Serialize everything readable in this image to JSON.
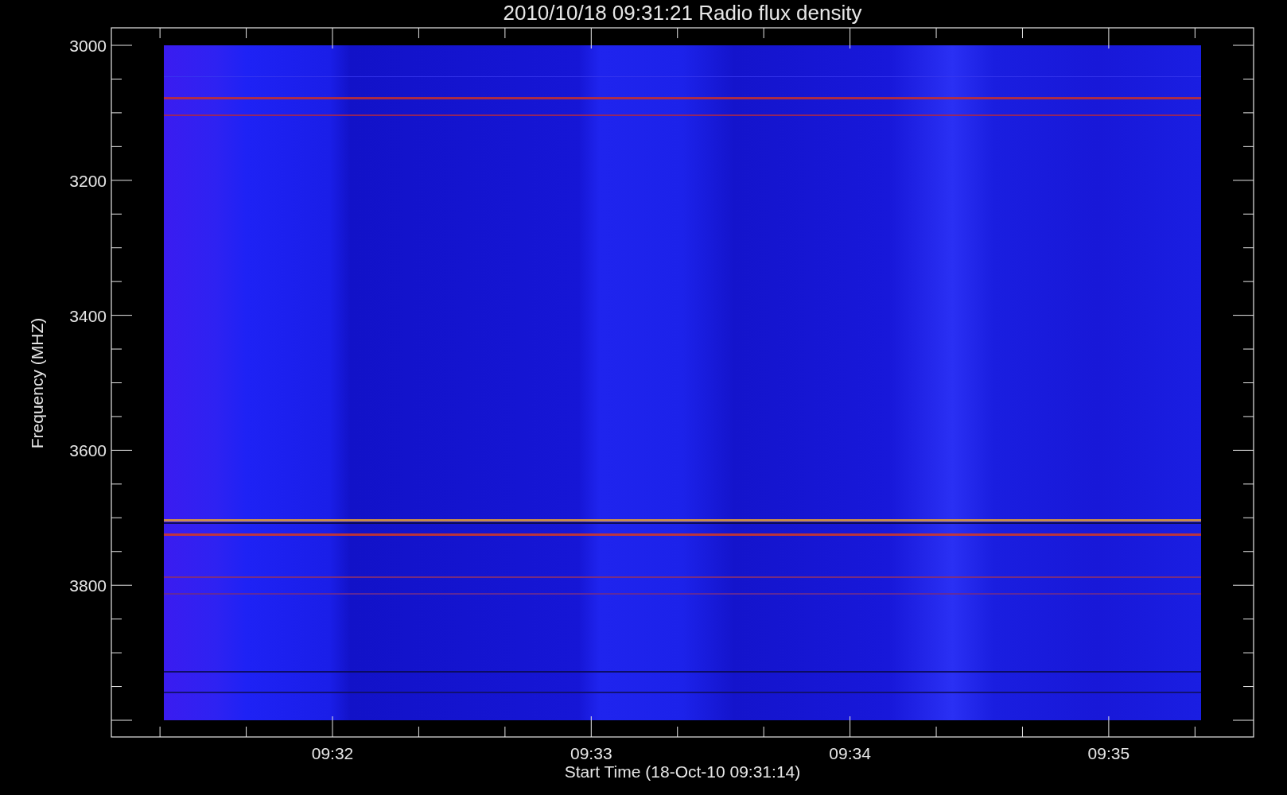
{
  "plot": {
    "title": "2010/10/18 09:31:21 Radio flux density",
    "y_axis": {
      "title": "Frequency (MHZ)",
      "tick_labels": [
        "3000",
        "3200",
        "3400",
        "3600",
        "3800"
      ]
    },
    "x_axis": {
      "title": "Start Time (18-Oct-10 09:31:14)",
      "tick_labels": [
        "09:32",
        "09:33",
        "09:34",
        "09:35"
      ]
    }
  }
}
